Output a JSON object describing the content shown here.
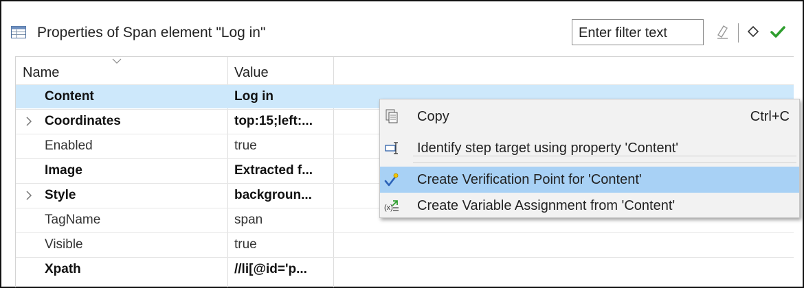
{
  "panel": {
    "title": "Properties of Span element \"Log in\"",
    "filter_text": "Enter filter text"
  },
  "table": {
    "headers": {
      "name": "Name",
      "value": "Value"
    },
    "rows": [
      {
        "name": "Content",
        "value": "Log in",
        "bold": true,
        "expandable": false,
        "selected": true
      },
      {
        "name": "Coordinates",
        "value": "top:15;left:...",
        "bold": true,
        "expandable": true,
        "selected": false
      },
      {
        "name": "Enabled",
        "value": "true",
        "bold": false,
        "expandable": false,
        "selected": false
      },
      {
        "name": "Image",
        "value": "Extracted f...",
        "bold": true,
        "expandable": false,
        "selected": false
      },
      {
        "name": "Style",
        "value": "backgroun...",
        "bold": true,
        "expandable": true,
        "selected": false
      },
      {
        "name": "TagName",
        "value": "span",
        "bold": false,
        "expandable": false,
        "selected": false
      },
      {
        "name": "Visible",
        "value": "true",
        "bold": false,
        "expandable": false,
        "selected": false
      },
      {
        "name": "Xpath",
        "value": "//li[@id='p...",
        "bold": true,
        "expandable": false,
        "selected": false
      }
    ]
  },
  "context_menu": {
    "items": [
      {
        "label": "Copy",
        "accelerator": "Ctrl+C",
        "icon": "copy-icon",
        "highlighted": false
      },
      {
        "label": "Identify step target using property 'Content'",
        "icon": "identify-target-icon",
        "highlighted": false
      },
      {
        "label": "Create Verification Point for 'Content'",
        "icon": "verification-point-icon",
        "highlighted": true
      },
      {
        "label": "Create Variable Assignment from 'Content'",
        "icon": "variable-assignment-icon",
        "highlighted": false
      }
    ]
  },
  "colors": {
    "selection": "#cde8fb",
    "menu_highlight": "#a8d1f5",
    "check_green": "#2e9e2e"
  }
}
